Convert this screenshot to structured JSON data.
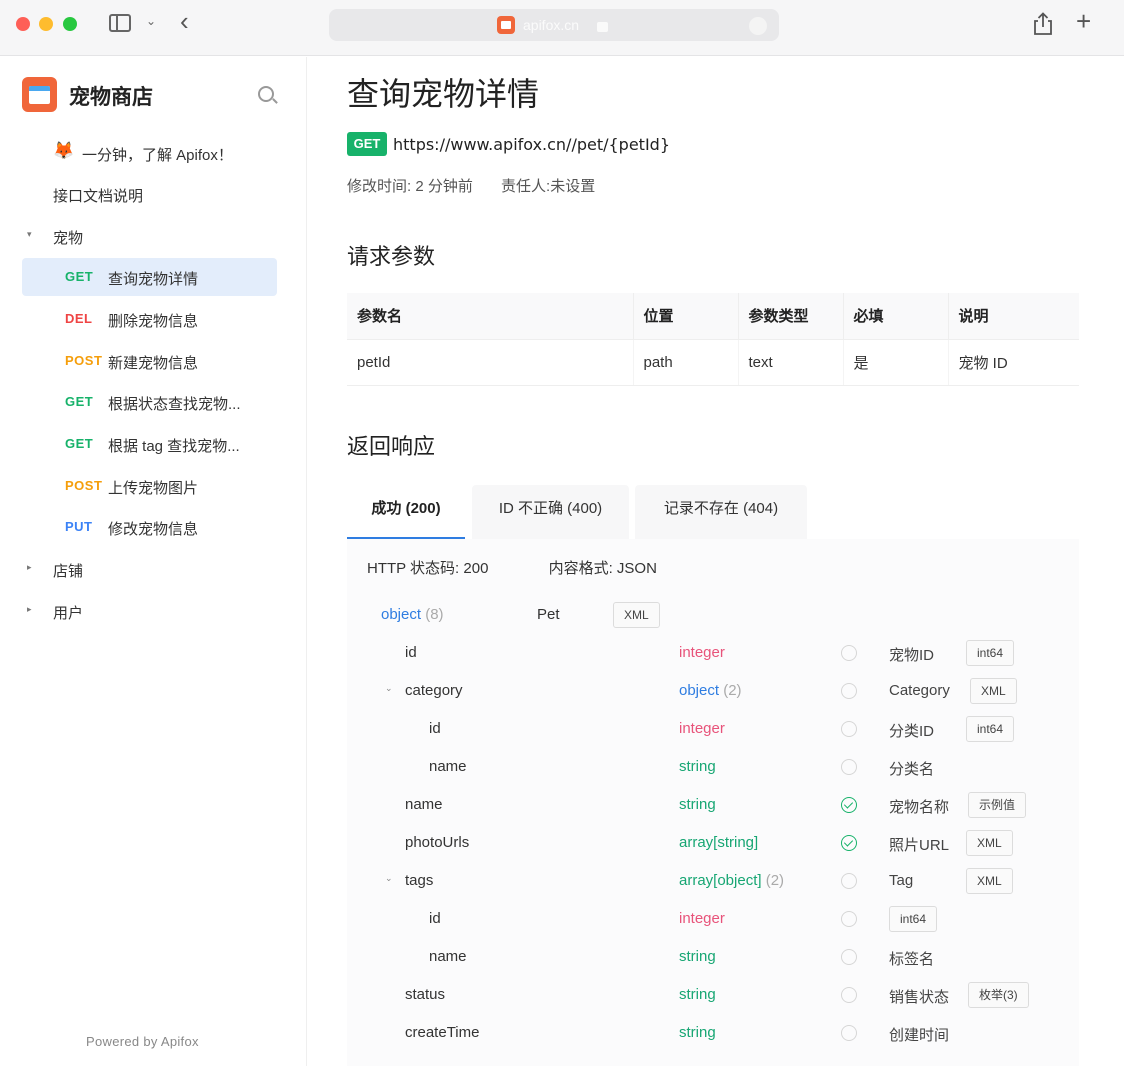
{
  "browser": {
    "url_domain": "apifox.cn"
  },
  "sidebar": {
    "project_name": "宠物商店",
    "items": [
      {
        "label": "一分钟，了解 Apifox！"
      },
      {
        "label": "接口文档说明"
      },
      {
        "label": "宠物"
      },
      {
        "method": "GET",
        "label": "查询宠物详情"
      },
      {
        "method": "DEL",
        "label": "删除宠物信息"
      },
      {
        "method": "POST",
        "label": "新建宠物信息"
      },
      {
        "method": "GET",
        "label": "根据状态查找宠物..."
      },
      {
        "method": "GET",
        "label": "根据 tag 查找宠物..."
      },
      {
        "method": "POST",
        "label": "上传宠物图片"
      },
      {
        "method": "PUT",
        "label": "修改宠物信息"
      },
      {
        "label": "店铺"
      },
      {
        "label": "用户"
      }
    ],
    "powered_by": "Powered by Apifox"
  },
  "main": {
    "title": "查询宠物详情",
    "method": "GET",
    "url": "https://www.apifox.cn//pet/{petId}",
    "modified": "修改时间: 2 分钟前",
    "owner": "责任人:未设置",
    "params_title": "请求参数",
    "params_headers": [
      "参数名",
      "位置",
      "参数类型",
      "必填",
      "说明"
    ],
    "params_rows": [
      [
        "petId",
        "path",
        "text",
        "是",
        "宠物 ID"
      ]
    ],
    "response_title": "返回响应",
    "tabs": [
      "成功 (200)",
      "ID 不正确 (400)",
      "记录不存在 (404)"
    ],
    "status_code": "HTTP 状态码: 200",
    "content_type": "内容格式: JSON",
    "schema_root": {
      "name": "object",
      "count": "(8)",
      "model": "Pet",
      "tag": "XML"
    },
    "schema": [
      {
        "name": "id",
        "type": "integer",
        "count": "",
        "required": false,
        "desc": "宠物ID",
        "tag": "int64"
      },
      {
        "name": "category",
        "type": "object",
        "count": "(2)",
        "required": false,
        "desc": "Category",
        "tag": "XML"
      },
      {
        "name": "id",
        "type": "integer",
        "count": "",
        "required": false,
        "desc": "分类ID",
        "tag": "int64"
      },
      {
        "name": "name",
        "type": "string",
        "count": "",
        "required": false,
        "desc": "分类名",
        "tag": ""
      },
      {
        "name": "name",
        "type": "string",
        "count": "",
        "required": true,
        "desc": "宠物名称",
        "tag": "示例值"
      },
      {
        "name": "photoUrls",
        "type": "array[string]",
        "count": "",
        "required": true,
        "desc": "照片URL",
        "tag": "XML"
      },
      {
        "name": "tags",
        "type": "array[object]",
        "count": "(2)",
        "required": false,
        "desc": "Tag",
        "tag": "XML"
      },
      {
        "name": "id",
        "type": "integer",
        "count": "",
        "required": false,
        "desc": "",
        "tag": "int64"
      },
      {
        "name": "name",
        "type": "string",
        "count": "",
        "required": false,
        "desc": "标签名",
        "tag": ""
      },
      {
        "name": "status",
        "type": "string",
        "count": "",
        "required": false,
        "desc": "销售状态",
        "tag": "枚举(3)"
      },
      {
        "name": "createTime",
        "type": "string",
        "count": "",
        "required": false,
        "desc": "创建时间",
        "tag": ""
      }
    ]
  },
  "colors": {
    "accent": "#2f7de1",
    "get": "#17b26a",
    "delete": "#ef4444",
    "post": "#f59e0b",
    "put": "#3b82f6",
    "brand": "#f0663a"
  }
}
